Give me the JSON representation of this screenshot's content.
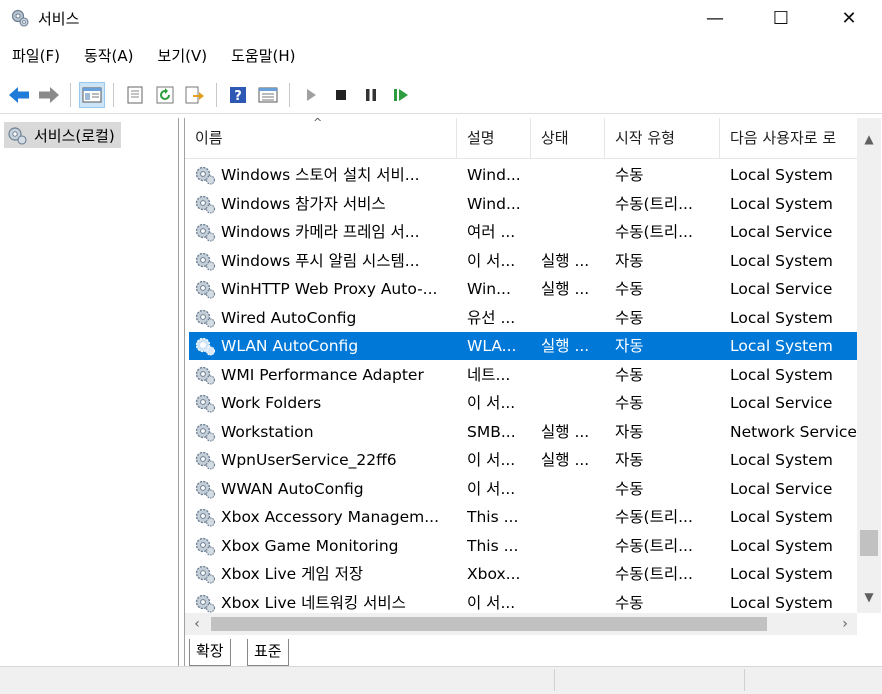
{
  "window": {
    "title": "서비스",
    "controls": {
      "minimize": "—",
      "maximize": "☐",
      "close": "✕"
    }
  },
  "menu": [
    "파일(F)",
    "동작(A)",
    "보기(V)",
    "도움말(H)"
  ],
  "toolbar": {
    "buttons": [
      "back-icon",
      "forward-icon",
      "console-tree-icon",
      "properties-icon",
      "refresh-icon",
      "export-icon",
      "help-icon",
      "view-icon",
      "start-icon",
      "stop-icon",
      "pause-icon",
      "restart-icon"
    ]
  },
  "tree": {
    "label": "서비스(로컬)"
  },
  "columns": [
    "이름",
    "설명",
    "상태",
    "시작 유형",
    "다음 사용자로 로"
  ],
  "rows": [
    {
      "name": "Windows 스토어 설치 서비...",
      "desc": "Wind...",
      "status": "",
      "startup": "수동",
      "logon": "Local System"
    },
    {
      "name": "Windows 참가자 서비스",
      "desc": "Wind...",
      "status": "",
      "startup": "수동(트리...",
      "logon": "Local System"
    },
    {
      "name": "Windows 카메라 프레임 서...",
      "desc": "여러 ...",
      "status": "",
      "startup": "수동(트리...",
      "logon": "Local Service"
    },
    {
      "name": "Windows 푸시 알림 시스템...",
      "desc": "이 서...",
      "status": "실행 ...",
      "startup": "자동",
      "logon": "Local System"
    },
    {
      "name": "WinHTTP Web Proxy Auto-...",
      "desc": "Win...",
      "status": "실행 ...",
      "startup": "수동",
      "logon": "Local Service"
    },
    {
      "name": "Wired AutoConfig",
      "desc": "유선 ...",
      "status": "",
      "startup": "수동",
      "logon": "Local System"
    },
    {
      "name": "WLAN AutoConfig",
      "desc": "WLA...",
      "status": "실행 ...",
      "startup": "자동",
      "logon": "Local System",
      "selected": true
    },
    {
      "name": "WMI Performance Adapter",
      "desc": "네트...",
      "status": "",
      "startup": "수동",
      "logon": "Local System"
    },
    {
      "name": "Work Folders",
      "desc": "이 서...",
      "status": "",
      "startup": "수동",
      "logon": "Local Service"
    },
    {
      "name": "Workstation",
      "desc": "SMB...",
      "status": "실행 ...",
      "startup": "자동",
      "logon": "Network Service"
    },
    {
      "name": "WpnUserService_22ff6",
      "desc": "이 서...",
      "status": "실행 ...",
      "startup": "자동",
      "logon": "Local System"
    },
    {
      "name": "WWAN AutoConfig",
      "desc": "이 서...",
      "status": "",
      "startup": "수동",
      "logon": "Local Service"
    },
    {
      "name": "Xbox Accessory Managem...",
      "desc": "This ...",
      "status": "",
      "startup": "수동(트리...",
      "logon": "Local System"
    },
    {
      "name": "Xbox Game Monitoring",
      "desc": "This ...",
      "status": "",
      "startup": "수동(트리...",
      "logon": "Local System"
    },
    {
      "name": "Xbox Live 게임 저장",
      "desc": "Xbox...",
      "status": "",
      "startup": "수동(트리...",
      "logon": "Local System"
    },
    {
      "name": "Xbox Live 네트워킹 서비스",
      "desc": "이 서...",
      "status": "",
      "startup": "수동",
      "logon": "Local System"
    }
  ],
  "tabs": [
    "확장",
    "표준"
  ],
  "colors": {
    "selection": "#0078d7",
    "toolbar_active": "#cce4f7"
  }
}
